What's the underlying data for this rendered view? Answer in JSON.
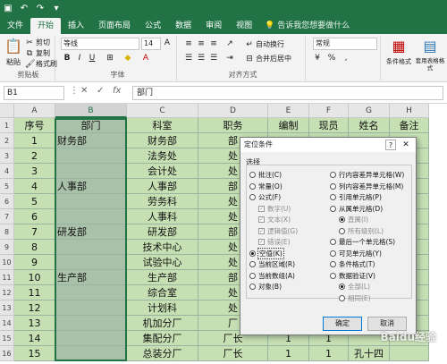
{
  "qat": {
    "save_icon": "save-icon",
    "undo_icon": "undo-icon",
    "redo_icon": "redo-icon"
  },
  "tabs": [
    "文件",
    "开始",
    "插入",
    "页面布局",
    "公式",
    "数据",
    "审阅",
    "视图"
  ],
  "tell_me": "告诉我您想要做什么",
  "ribbon": {
    "clipboard": {
      "label": "剪贴板",
      "paste": "粘贴",
      "cut": "剪切",
      "copy": "复制",
      "format_painter": "格式刷"
    },
    "font": {
      "label": "字体",
      "name": "等线",
      "size": "14",
      "bold": "B",
      "italic": "I",
      "underline": "U"
    },
    "alignment": {
      "label": "对齐方式",
      "wrap": "自动换行",
      "merge": "合并后居中"
    },
    "number": {
      "format": "常规"
    },
    "styles": {
      "conditional": "条件格式",
      "table": "套用表格格式"
    }
  },
  "formula_bar": {
    "name_box": "B1",
    "value": "部门"
  },
  "columns": [
    "A",
    "B",
    "C",
    "D",
    "E",
    "F",
    "G",
    "H"
  ],
  "rows": [
    [
      "序号",
      "部门",
      "科室",
      "职务",
      "编制",
      "现员",
      "姓名",
      "备注"
    ],
    [
      "1",
      "财务部",
      "财务部",
      "部",
      "",
      "",
      "",
      ""
    ],
    [
      "2",
      "",
      "法务处",
      "处",
      "",
      "",
      "",
      ""
    ],
    [
      "3",
      "",
      "会计处",
      "处",
      "",
      "",
      "",
      ""
    ],
    [
      "4",
      "人事部",
      "人事部",
      "部",
      "",
      "",
      "",
      ""
    ],
    [
      "5",
      "",
      "劳务科",
      "处",
      "",
      "",
      "",
      ""
    ],
    [
      "6",
      "",
      "人事科",
      "处",
      "",
      "",
      "",
      ""
    ],
    [
      "7",
      "研发部",
      "研发部",
      "部",
      "",
      "",
      "",
      ""
    ],
    [
      "8",
      "",
      "技术中心",
      "处",
      "",
      "",
      "",
      ""
    ],
    [
      "9",
      "",
      "试验中心",
      "处",
      "",
      "",
      "",
      ""
    ],
    [
      "10",
      "生产部",
      "生产部",
      "部",
      "",
      "",
      "",
      ""
    ],
    [
      "11",
      "",
      "综合室",
      "处",
      "",
      "",
      "",
      ""
    ],
    [
      "12",
      "",
      "计划科",
      "处",
      "",
      "",
      "",
      ""
    ],
    [
      "13",
      "",
      "机加分厂",
      "厂",
      "",
      "",
      "",
      ""
    ],
    [
      "14",
      "",
      "集配分厂",
      "厂长",
      "1",
      "1",
      "",
      ""
    ],
    [
      "15",
      "",
      "总装分厂",
      "厂长",
      "1",
      "1",
      "孔十四",
      ""
    ]
  ],
  "dialog": {
    "title": "定位条件",
    "help": "?",
    "close": "✕",
    "section": "选择",
    "left_options": [
      {
        "label": "批注(C)",
        "type": "radio",
        "checked": false,
        "disabled": false
      },
      {
        "label": "常量(O)",
        "type": "radio",
        "checked": false,
        "disabled": false
      },
      {
        "label": "公式(F)",
        "type": "radio",
        "checked": false,
        "disabled": false
      },
      {
        "label": "数字(U)",
        "type": "check",
        "checked": true,
        "disabled": true
      },
      {
        "label": "文本(X)",
        "type": "check",
        "checked": true,
        "disabled": true
      },
      {
        "label": "逻辑值(G)",
        "type": "check",
        "checked": true,
        "disabled": true
      },
      {
        "label": "错误(E)",
        "type": "check",
        "checked": true,
        "disabled": true
      },
      {
        "label": "空值(K)",
        "type": "radio",
        "checked": true,
        "disabled": false
      },
      {
        "label": "当前区域(R)",
        "type": "radio",
        "checked": false,
        "disabled": false
      },
      {
        "label": "当前数组(A)",
        "type": "radio",
        "checked": false,
        "disabled": false
      },
      {
        "label": "对象(B)",
        "type": "radio",
        "checked": false,
        "disabled": false
      }
    ],
    "right_options": [
      {
        "label": "行内容差异单元格(W)",
        "type": "radio",
        "checked": false,
        "disabled": false
      },
      {
        "label": "列内容差异单元格(M)",
        "type": "radio",
        "checked": false,
        "disabled": false
      },
      {
        "label": "引用单元格(P)",
        "type": "radio",
        "checked": false,
        "disabled": false
      },
      {
        "label": "从属单元格(D)",
        "type": "radio",
        "checked": false,
        "disabled": false
      },
      {
        "label": "直属(I)",
        "type": "radio",
        "checked": true,
        "disabled": true
      },
      {
        "label": "所有级别(L)",
        "type": "radio",
        "checked": false,
        "disabled": true
      },
      {
        "label": "最后一个单元格(S)",
        "type": "radio",
        "checked": false,
        "disabled": false
      },
      {
        "label": "可见单元格(Y)",
        "type": "radio",
        "checked": false,
        "disabled": false
      },
      {
        "label": "条件格式(T)",
        "type": "radio",
        "checked": false,
        "disabled": false
      },
      {
        "label": "数据验证(V)",
        "type": "radio",
        "checked": false,
        "disabled": false
      },
      {
        "label": "全部(L)",
        "type": "radio",
        "checked": true,
        "disabled": true
      },
      {
        "label": "相同(E)",
        "type": "radio",
        "checked": false,
        "disabled": true
      }
    ],
    "ok": "确定",
    "cancel": "取消"
  },
  "colors": {
    "accent": "#217346",
    "grid_fill": "#c6e0b4",
    "selected_column": "#a9c1a9"
  },
  "watermark": "Baidu经验"
}
